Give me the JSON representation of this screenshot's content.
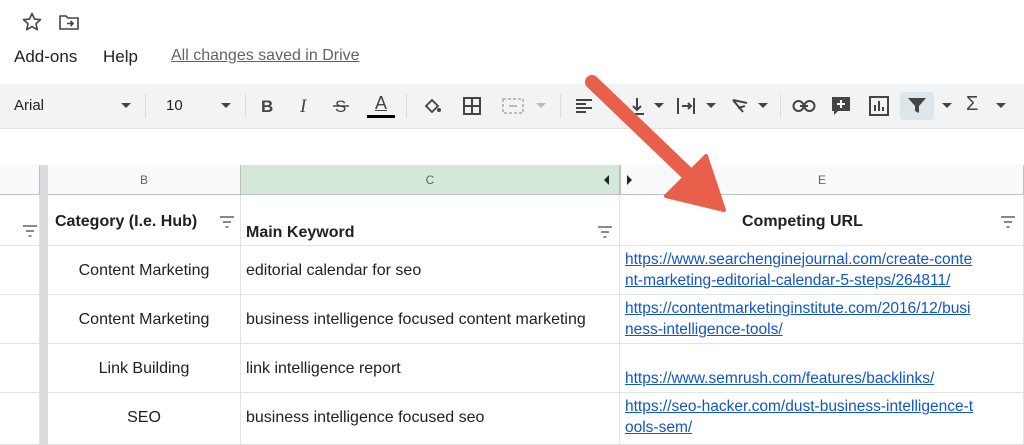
{
  "menu": {
    "addons_label": "Add-ons",
    "help_label": "Help",
    "saved_status": "All changes saved in Drive"
  },
  "toolbar": {
    "font_family": "Arial",
    "font_size": "10",
    "text_color_letter": "A",
    "sum_symbol": "Σ"
  },
  "columns": {
    "b_letter": "B",
    "c_letter": "C",
    "e_letter": "E"
  },
  "table": {
    "headers": {
      "category": "Category (I.e. Hub)",
      "keyword": "Main Keyword",
      "url": "Competing URL"
    },
    "rows": [
      {
        "category": "Content Marketing",
        "keyword": "editorial calendar for seo",
        "url_line1": "https://www.searchenginejournal.com/create-conte",
        "url_line2": "nt-marketing-editorial-calendar-5-steps/264811/"
      },
      {
        "category": "Content Marketing",
        "keyword": "business intelligence focused content marketing",
        "url_line1": "https://contentmarketinginstitute.com/2016/12/busi",
        "url_line2": "ness-intelligence-tools/"
      },
      {
        "category": "Link Building",
        "keyword": "link intelligence report",
        "url_line1": "",
        "url_line2": "https://www.semrush.com/features/backlinks/"
      },
      {
        "category": "SEO",
        "keyword": "business intelligence focused seo",
        "url_line1": "https://seo-hacker.com/dust-business-intelligence-t",
        "url_line2": "ools-sem/"
      }
    ]
  },
  "colors": {
    "arrow": "#e8604c",
    "link": "#1155cc",
    "selected_column": "#d3e8d9"
  }
}
